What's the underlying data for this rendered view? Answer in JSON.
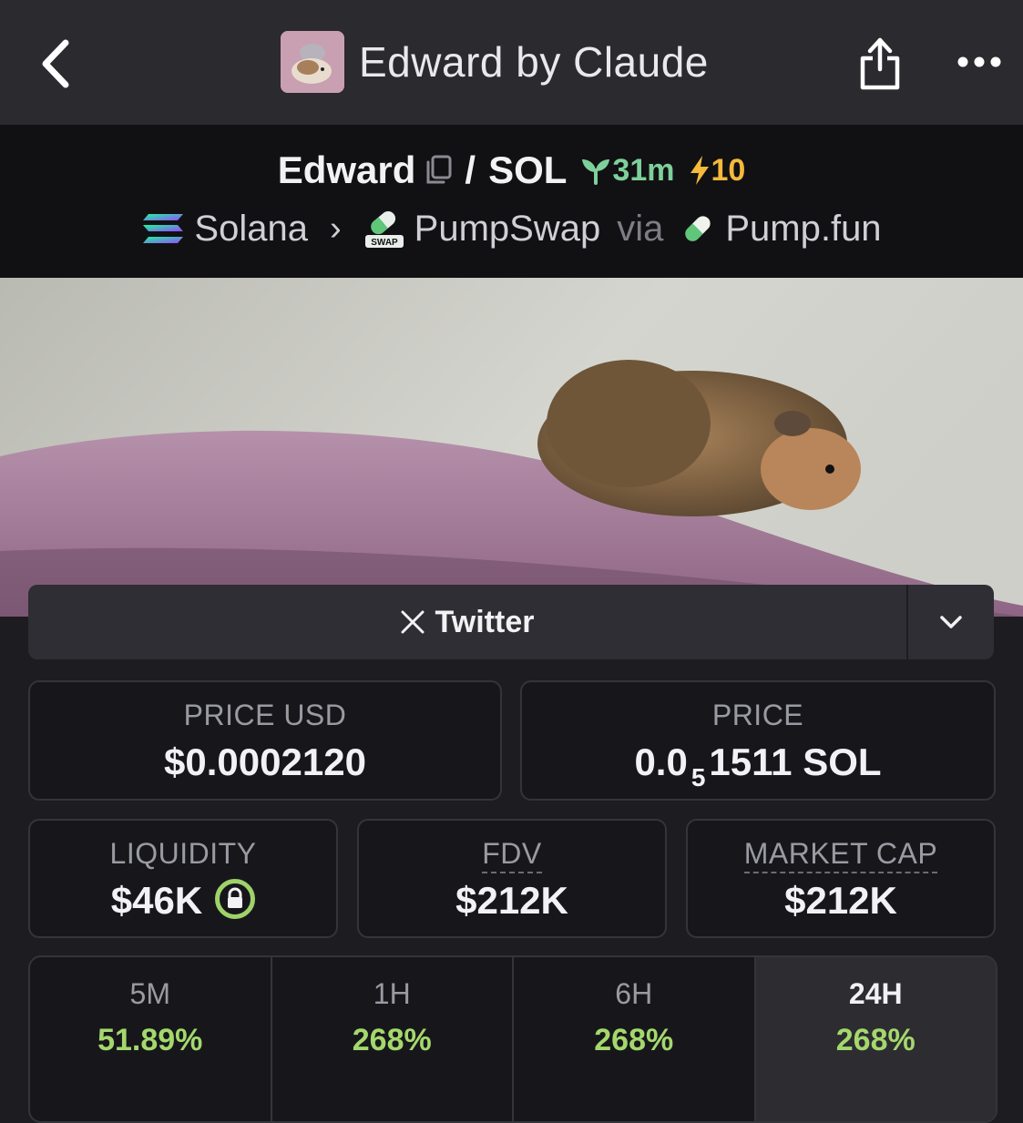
{
  "header": {
    "title": "Edward by Claude",
    "back_icon": "chevron-left-icon",
    "share_icon": "share-icon",
    "more_icon": "more-dots-icon"
  },
  "pair": {
    "base": "Edward",
    "separator": "/",
    "quote": "SOL",
    "age": "31m",
    "boosts": "10",
    "chain": "Solana",
    "dex": "PumpSwap",
    "via": "via",
    "launchpad": "Pump.fun"
  },
  "links": {
    "twitter_label": "Twitter"
  },
  "stats": {
    "price_usd_label": "PRICE USD",
    "price_usd_value": "$0.0002120",
    "price_label": "PRICE",
    "price_prefix": "0.0",
    "price_subscript": "5",
    "price_digits": "1511 SOL",
    "liquidity_label": "LIQUIDITY",
    "liquidity_value": "$46K",
    "fdv_label": "FDV",
    "fdv_value": "$212K",
    "mcap_label": "MARKET CAP",
    "mcap_value": "$212K"
  },
  "timeframes": [
    {
      "label": "5M",
      "value": "51.89%"
    },
    {
      "label": "1H",
      "value": "268%"
    },
    {
      "label": "6H",
      "value": "268%"
    },
    {
      "label": "24H",
      "value": "268%"
    }
  ],
  "colors": {
    "positive": "#a4d86c",
    "age": "#7ed09a",
    "boost": "#f5b93b"
  }
}
